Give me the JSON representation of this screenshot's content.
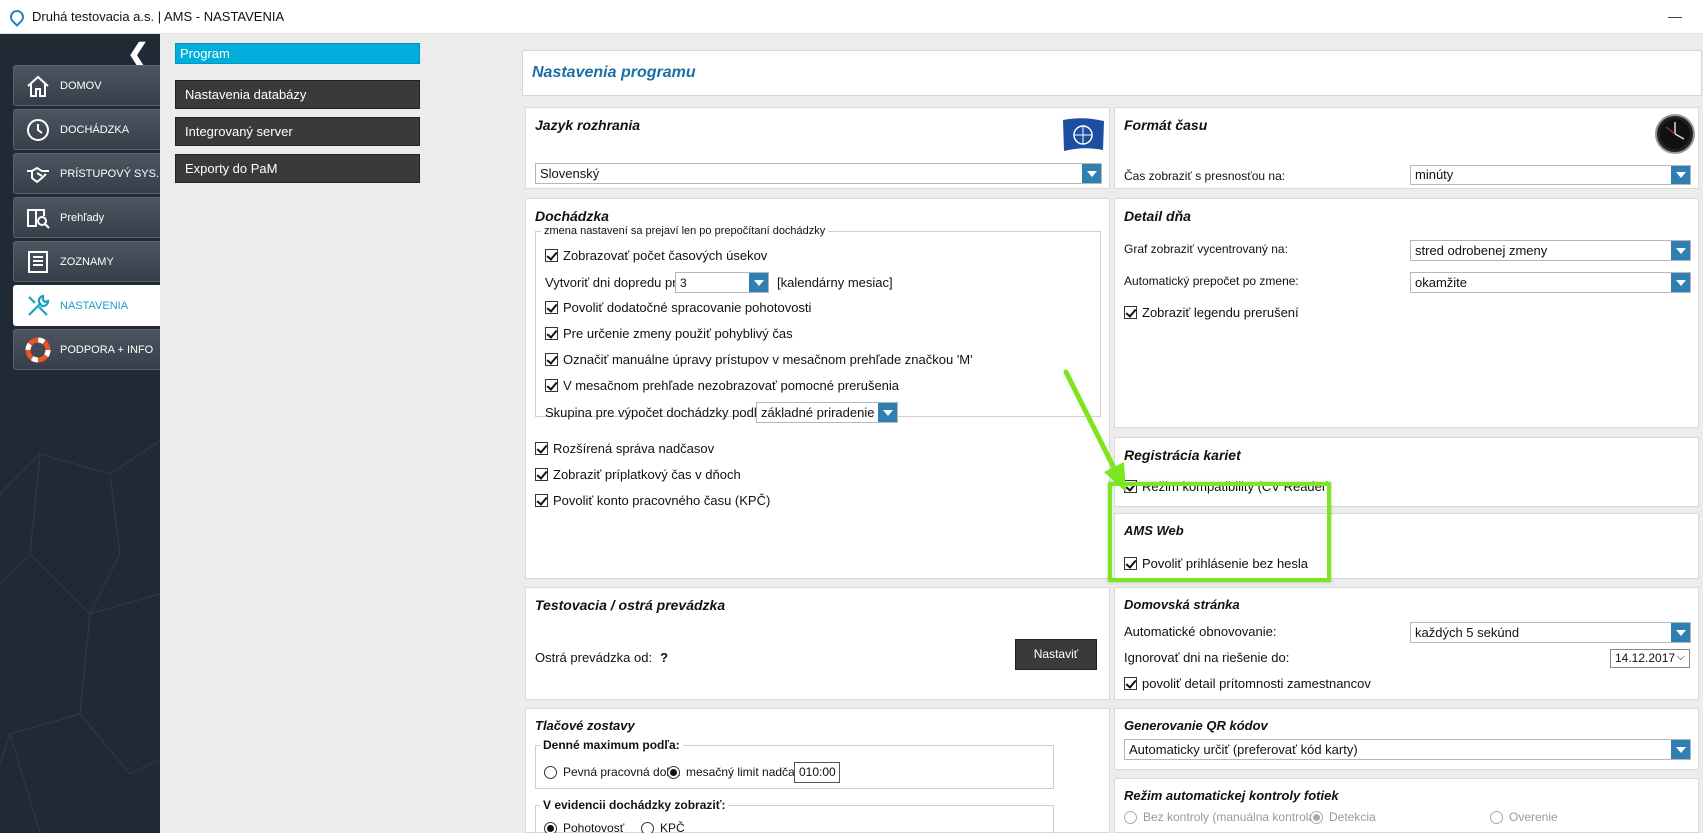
{
  "window": {
    "title": "Druhá testovacia a.s. | AMS - NASTAVENIA",
    "minimize": "—"
  },
  "sidebar": {
    "collapse": "❮",
    "items": [
      {
        "label": "DOMOV",
        "icon": "home-icon"
      },
      {
        "label": "DOCHÁDZKA",
        "icon": "clock-icon"
      },
      {
        "label": "PRÍSTUPOVÝ SYS.",
        "icon": "handshake-icon"
      },
      {
        "label": "Prehľady",
        "icon": "book-search-icon"
      },
      {
        "label": "ZOZNAMY",
        "icon": "list-icon"
      },
      {
        "label": "NASTAVENIA",
        "icon": "tools-icon"
      },
      {
        "label": "PODPORA + INFO",
        "icon": "lifebuoy-icon"
      }
    ]
  },
  "menu": {
    "items": [
      "Program",
      "Nastavenia databázy",
      "Integrovaný server",
      "Exporty do PaM"
    ]
  },
  "page": {
    "title": "Nastavenia programu"
  },
  "language": {
    "title": "Jazyk rozhrania",
    "value": "Slovenský",
    "icon": "un-flag-icon"
  },
  "time_format": {
    "title": "Formát času",
    "label": "Čas zobraziť s presnosťou na:",
    "value": "minúty",
    "icon": "clock-icon"
  },
  "attendance": {
    "title": "Dochádzka",
    "group_label": "zmena nastavení sa prejaví len po prepočítaní dochádzky",
    "show_segments": "Zobrazovať počet časových úsekov",
    "create_days_label": "Vytvoriť dni dopredu pre",
    "create_days_value": "3",
    "create_days_unit": "[kalendárny mesiac]",
    "allow_standby": "Povoliť dodatočné spracovanie pohotovosti",
    "flexible_time": "Pre určenie zmeny použiť pohyblivý čas",
    "mark_manual": "Označiť manuálne úpravy prístupov v mesačnom prehľade značkou 'M'",
    "hide_breaks": "V mesačnom prehľade nezobrazovať pomocné prerušenia",
    "group_calc_label": "Skupina pre výpočet dochádzky podľa:",
    "group_calc_value": "základné priradenie",
    "overtime": "Rozšírená správa nadčasov",
    "surcharge": "Zobraziť príplatkový čas v dňoch",
    "kpc": "Povoliť konto pracovného času (KPČ)"
  },
  "day_detail": {
    "title": "Detail dňa",
    "graph_label": "Graf zobraziť vycentrovaný na:",
    "graph_value": "stred odrobenej zmeny",
    "recalc_label": "Automatický prepočet po zmene:",
    "recalc_value": "okamžite",
    "legend": "Zobraziť legendu prerušení"
  },
  "cards": {
    "title": "Registrácia kariet",
    "compat": "Režim kompatibility (CV Reader)"
  },
  "ams_web": {
    "title": "AMS Web",
    "nopass": "Povoliť prihlásenie bez hesla"
  },
  "testing": {
    "title": "Testovacia / ostrá prevádzka",
    "label": "Ostrá prevádzka od:",
    "value": "?",
    "button": "Nastaviť"
  },
  "homepage": {
    "title": "Domovská stránka",
    "refresh_label": "Automatické obnovovanie:",
    "refresh_value": "každých 5 sekúnd",
    "ignore_label": "Ignorovať dni na riešenie do:",
    "ignore_value": "14.12.2017",
    "presence": "povoliť detail prítomnosti zamestnancov"
  },
  "print": {
    "title": "Tlačové zostavy",
    "daily_max_label": "Denné maximum podľa:",
    "fixed": "Pevná pracovná doba",
    "monthly": "mesačný limit nadčasu:",
    "monthly_value": "010:00",
    "evid_label": "V evidencii dochádzky zobraziť:",
    "standby": "Pohotovosť",
    "kpc": "KPČ"
  },
  "qr": {
    "title": "Generovanie QR kódov",
    "value": "Automaticky určiť (preferovať kód karty)"
  },
  "photos": {
    "title": "Režim automatickej kontroly fotiek",
    "none": "Bez kontroly (manuálna kontrola)",
    "detect": "Detekcia",
    "verify": "Overenie"
  }
}
